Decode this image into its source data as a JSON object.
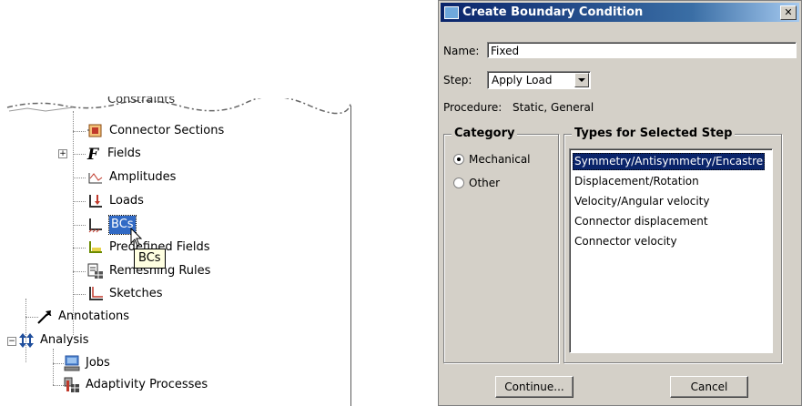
{
  "tree": {
    "items": [
      {
        "label": "Connector Sections",
        "icon": "connector-sections-icon"
      },
      {
        "label": "Fields",
        "icon": "fields-icon"
      },
      {
        "label": "Amplitudes",
        "icon": "amplitudes-icon"
      },
      {
        "label": "Loads",
        "icon": "loads-icon"
      },
      {
        "label": "BCs",
        "icon": "bcs-icon"
      },
      {
        "label": "Predefined Fields",
        "icon": "predefined-fields-icon"
      },
      {
        "label": "Remeshing Rules",
        "icon": "remeshing-rules-icon"
      },
      {
        "label": "Sketches",
        "icon": "sketches-icon"
      },
      {
        "label": "Annotations",
        "icon": "annotations-icon"
      },
      {
        "label": "Analysis",
        "icon": "analysis-icon"
      },
      {
        "label": "Jobs",
        "icon": "jobs-icon"
      },
      {
        "label": "Adaptivity Processes",
        "icon": "adaptivity-processes-icon"
      }
    ],
    "partial_label": "Constraints",
    "tooltip": "BCs"
  },
  "dialog": {
    "title": "Create Boundary Condition",
    "close_label": "✕",
    "name_label": "Name:",
    "name_value": "Fixed",
    "step_label": "Step:",
    "step_value": "Apply Load",
    "procedure_label": "Procedure:",
    "procedure_value": "Static, General",
    "category_title": "Category",
    "categories": [
      {
        "label": "Mechanical",
        "selected": true
      },
      {
        "label": "Other",
        "selected": false
      }
    ],
    "types_title": "Types for Selected Step",
    "types": [
      "Symmetry/Antisymmetry/Encastre",
      "Displacement/Rotation",
      "Velocity/Angular velocity",
      "Connector displacement",
      "Connector velocity"
    ],
    "continue_label": "Continue...",
    "cancel_label": "Cancel"
  },
  "colors": {
    "selection": "#316ac5",
    "title_bar": "#0a246a",
    "dialog_bg": "#d4d0c8",
    "tooltip_bg": "#ffffe1"
  }
}
